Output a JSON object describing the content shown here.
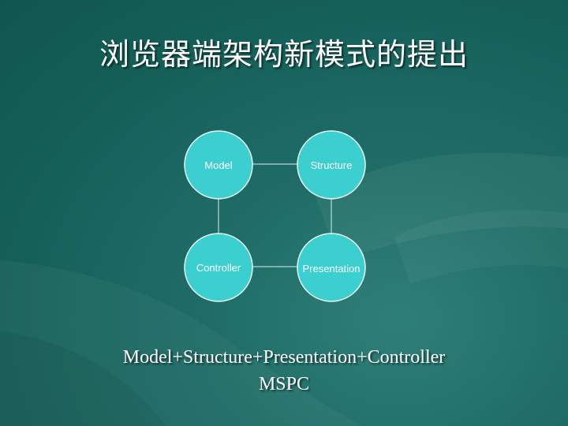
{
  "slide": {
    "title": "浏览器端架构新模式的提出",
    "caption_line1": "Model+Structure+Presentation+Controller",
    "caption_line2": "MSPC"
  },
  "diagram": {
    "nodes": [
      "Model",
      "Structure",
      "Controller",
      "Presentation"
    ],
    "node_color": "#3ccfcf",
    "edge_color": "#d9efee"
  }
}
